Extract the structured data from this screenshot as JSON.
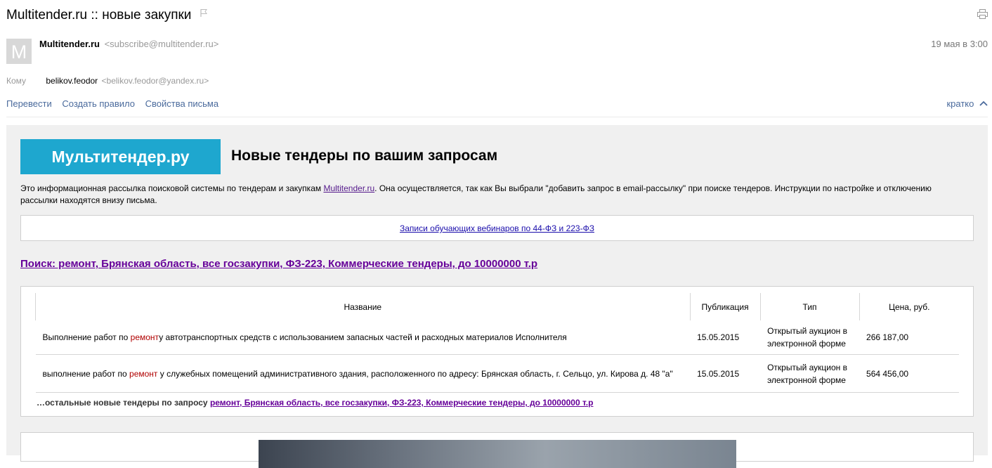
{
  "email": {
    "subject": "Multitender.ru :: новые закупки",
    "sender_initial": "M",
    "sender_name": "Multitender.ru",
    "sender_email": "<subscribe@multitender.ru>",
    "date": "19 мая в 3:00",
    "to_label": "Кому",
    "recipient_name": "belikov.feodor",
    "recipient_email": "<belikov.feodor@yandex.ru>",
    "actions": [
      "Перевести",
      "Создать правило",
      "Свойства письма"
    ],
    "brief_label": "кратко"
  },
  "letter": {
    "logo_text": "Мультитендер.ру",
    "headline": "Новые тендеры по вашим запросам",
    "intro_before": "Это информационная рассылка поисковой системы по тендерам и закупкам ",
    "intro_link": "Multitender.ru",
    "intro_after": ". Она осуществляется, так как Вы выбрали \"добавить запрос в email-рассылку\" при поиске тендеров. Инструкции по настройке и отключению рассылки находятся внизу письма.",
    "webinar_link": "Записи обучающих вебинаров по 44-ФЗ и 223-ФЗ",
    "search_link": "Поиск: ремонт, Брянская область, все госзакупки, ФЗ-223, Коммерческие тендеры, до 10000000 т.р",
    "table": {
      "headers": [
        "Название",
        "Публикация",
        "Тип",
        "Цена, руб."
      ],
      "rows": [
        {
          "name_before": "Выполнение работ по ",
          "name_highlight": "ремонт",
          "name_after": "у автотранспортных средств с использованием запасных частей и расходных материалов Исполнителя",
          "date": "15.05.2015",
          "type": "Открытый аукцион в электронной форме",
          "price": "266 187,00"
        },
        {
          "name_before": "выполнение работ по ",
          "name_highlight": "ремонт",
          "name_after": " у служебных помещений административного здания, расположенного по адресу: Брянская область, г. Сельцо, ул. Кирова д. 48 \"а\"",
          "date": "15.05.2015",
          "type": "Открытый аукцион в электронной форме",
          "price": "564 456,00"
        }
      ]
    },
    "more_prefix": "…остальные новые тендеры по запросу ",
    "more_link": "ремонт, Брянская область, все госзакупки, ФЗ-223, Коммерческие тендеры, до 10000000 т.р"
  },
  "colors": {
    "logo_bg": "#1ea7cf",
    "link_visited": "#660099",
    "keyword_highlight": "#b00000",
    "action_link": "#4a6a9c"
  }
}
